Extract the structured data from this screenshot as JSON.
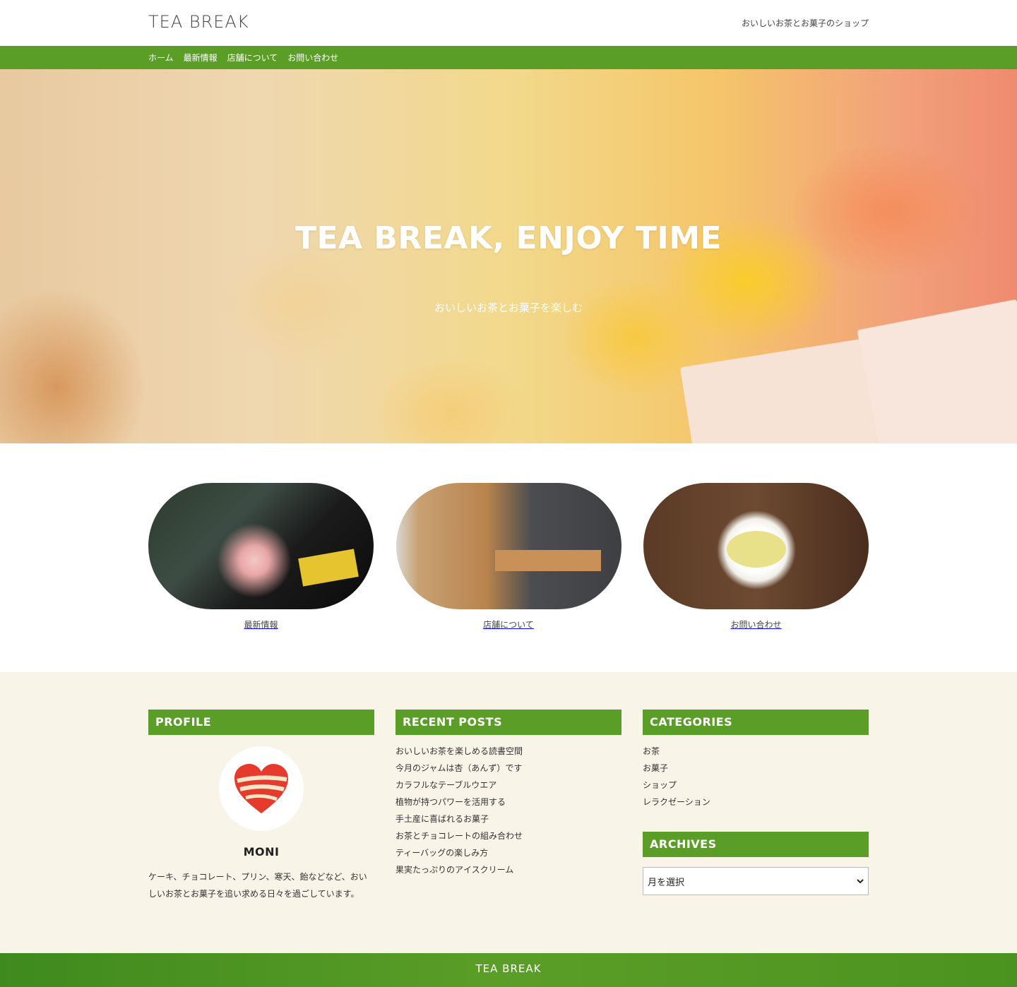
{
  "header": {
    "site_title": "TEA BREAK",
    "tagline": "おいしいお茶とお菓子のショップ"
  },
  "nav": {
    "items": [
      "ホーム",
      "最新情報",
      "店舗について",
      "お問い合わせ"
    ]
  },
  "hero": {
    "title": "TEA BREAK, ENJOY TIME",
    "subtitle": "おいしいお茶とお菓子を楽しむ"
  },
  "features": [
    {
      "label": "最新情報"
    },
    {
      "label": "店舗について"
    },
    {
      "label": "お問い合わせ"
    }
  ],
  "widgets": {
    "profile": {
      "title": "PROFILE",
      "name": "MONI",
      "text": "ケーキ、チョコレート、プリン、寒天、飴などなど、おいしいお茶とお菓子を追い求める日々を過ごしています。"
    },
    "recent_posts": {
      "title": "RECENT POSTS",
      "items": [
        "おいしいお茶を楽しめる読書空間",
        "今月のジャムは杏（あんず）です",
        "カラフルなテーブルウエア",
        "植物が持つパワーを活用する",
        "手土産に喜ばれるお菓子",
        "お茶とチョコレートの組み合わせ",
        "ティーバッグの楽しみ方",
        "果実たっぷりのアイスクリーム"
      ]
    },
    "categories": {
      "title": "CATEGORIES",
      "items": [
        "お茶",
        "お菓子",
        "ショップ",
        "レラクゼーション"
      ]
    },
    "archives": {
      "title": "ARCHIVES",
      "select_value": "月を選択"
    }
  },
  "footer": {
    "text": "TEA BREAK"
  },
  "colors": {
    "accent": "#5b9e27",
    "widget_bg": "#f9f4e8"
  }
}
